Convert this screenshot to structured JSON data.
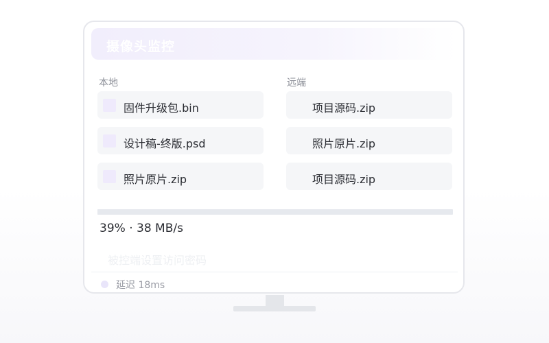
{
  "header": {
    "title": "摄像头监控"
  },
  "local": {
    "label": "本地",
    "files": [
      {
        "name": "固件升级包.bin",
        "icon": "file-icon"
      },
      {
        "name": "设计稿-终版.psd",
        "icon": "file-icon"
      },
      {
        "name": "照片原片.zip",
        "icon": "file-icon"
      }
    ]
  },
  "remote": {
    "label": "远端",
    "files": [
      {
        "name": "项目源码.zip"
      },
      {
        "name": "照片原片.zip"
      },
      {
        "name": "项目源码.zip"
      }
    ]
  },
  "transfer": {
    "progress_percent": 39,
    "status_text": "39% · 38 MB/s"
  },
  "password_hint": "被控端设置访问密码",
  "footer": {
    "latency": "延迟 18ms"
  },
  "colors": {
    "accent": "#efeafc",
    "item_bg": "#f5f6f8",
    "text": "#2b2d33",
    "muted": "#8a8d96"
  }
}
